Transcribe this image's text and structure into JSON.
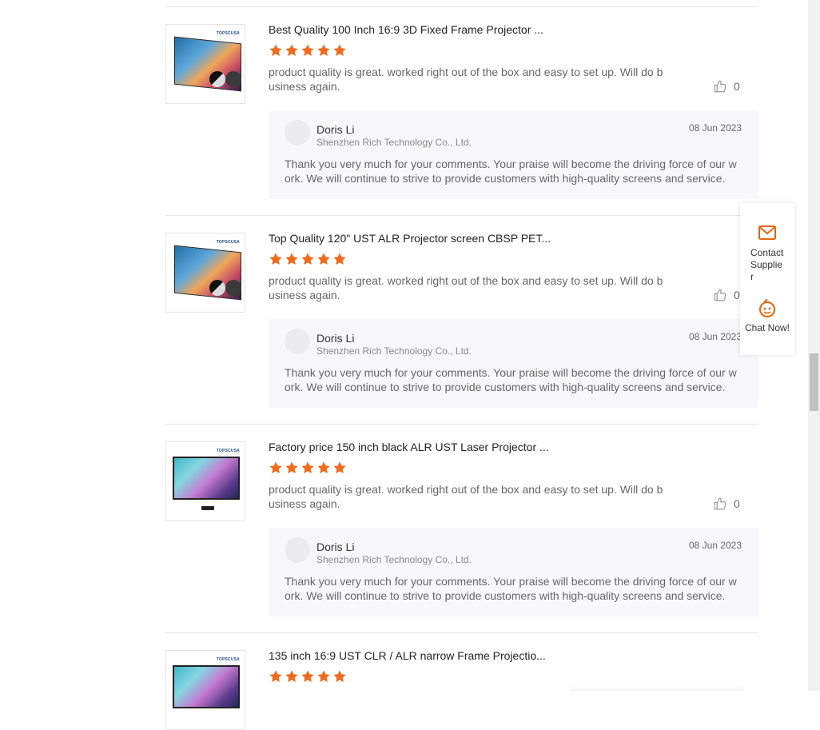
{
  "reviews": [
    {
      "product_title": "Best Quality 100 Inch 16:9 3D Fixed Frame Projector ...",
      "brand": "TOPSCUSA",
      "rating": 5,
      "text": "product quality is great. worked right out of the box and easy to set up. Will do business again.",
      "likes": "0",
      "reply": {
        "name": "Doris Li",
        "company": "Shenzhen Rich Technology Co., Ltd.",
        "date": "08 Jun 2023",
        "text": "Thank you very much for your comments. Your praise will become the driving force of our work. We will continue to strive to provide customers with high-quality screens and service."
      }
    },
    {
      "product_title": "Top Quality 120\" UST ALR Projector screen CBSP PET...",
      "brand": "TOPSCUSA",
      "rating": 5,
      "text": "product quality is great. worked right out of the box and easy to set up. Will do business again.",
      "likes": "0",
      "reply": {
        "name": "Doris Li",
        "company": "Shenzhen Rich Technology Co., Ltd.",
        "date": "08 Jun 2023",
        "text": "Thank you very much for your comments. Your praise will become the driving force of our work. We will continue to strive to provide customers with high-quality screens and service."
      }
    },
    {
      "product_title": "Factory price 150 inch black ALR UST Laser Projector ...",
      "brand": "TOPSCUSA",
      "rating": 5,
      "text": "product quality is great. worked right out of the box and easy to set up. Will do business again.",
      "likes": "0",
      "reply": {
        "name": "Doris Li",
        "company": "Shenzhen Rich Technology Co., Ltd.",
        "date": "08 Jun 2023",
        "text": "Thank you very much for your comments. Your praise will become the driving force of our work. We will continue to strive to provide customers with high-quality screens and service."
      }
    },
    {
      "product_title": "135 inch 16:9 UST CLR / ALR narrow Frame Projectio...",
      "brand": "TOPSCUSA",
      "rating": 5
    }
  ],
  "side_panel": {
    "contact_label": "Contact Supplier",
    "chat_label": "Chat Now!"
  },
  "colors": {
    "star": "#f26b1d",
    "accent": "#e8630a"
  }
}
